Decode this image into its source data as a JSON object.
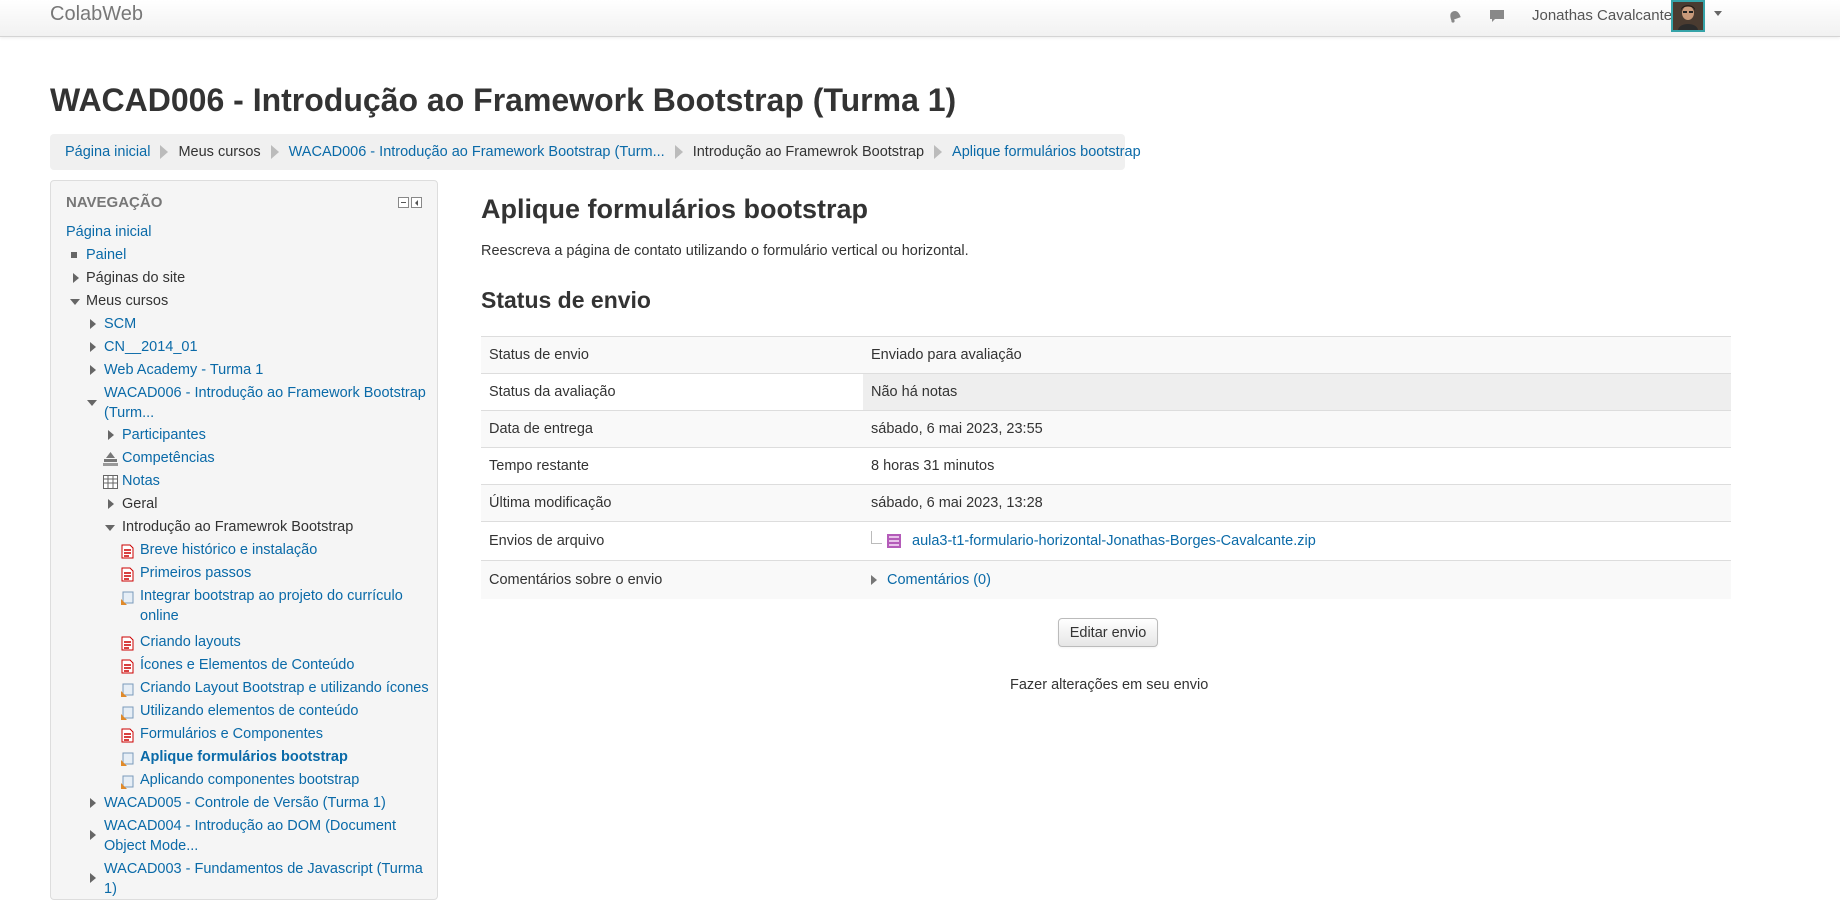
{
  "navbar": {
    "brand": "ColabWeb",
    "user_name": "Jonathas Cavalcante",
    "icons": [
      "notification-bell-icon",
      "messages-icon",
      "user-menu-caret-icon"
    ]
  },
  "page": {
    "heading": "WACAD006 - Introdução ao Framework Bootstrap (Turma 1)"
  },
  "breadcrumb": [
    {
      "label": "Página inicial",
      "link": true
    },
    {
      "label": "Meus cursos",
      "link": false
    },
    {
      "label": "WACAD006 - Introdução ao Framework Bootstrap (Turm...",
      "link": true
    },
    {
      "label": "Introdução ao Framewrok Bootstrap",
      "link": false
    },
    {
      "label": "Aplique formulários bootstrap",
      "link": true
    }
  ],
  "nav": {
    "title": "NAVEGAÇÃO",
    "home": "Página inicial",
    "painel": "Painel",
    "site_pages": "Páginas do site",
    "my_courses": "Meus cursos",
    "courses": {
      "scm": "SCM",
      "cn": "CN__2014_01",
      "web_academy": "Web Academy - Turma 1",
      "wacad006": "WACAD006 - Introdução ao Framework Bootstrap (Turm...",
      "wacad005": "WACAD005 - Controle de Versão (Turma 1)",
      "wacad004": "WACAD004 - Introdução ao DOM (Document Object Mode...",
      "wacad003": "WACAD003 - Fundamentos de Javascript (Turma 1)"
    },
    "course_items": {
      "participants": "Participantes",
      "competencies": "Competências",
      "grades": "Notas",
      "general": "Geral",
      "section": "Introdução ao Framewrok Bootstrap"
    },
    "activities": [
      {
        "label": "Breve histórico e instalação",
        "icon": "pdf-icon"
      },
      {
        "label": "Primeiros passos",
        "icon": "pdf-icon"
      },
      {
        "label": "Integrar bootstrap ao projeto do currículo online",
        "icon": "assignment-icon"
      },
      {
        "label": "Criando layouts",
        "icon": "pdf-icon"
      },
      {
        "label": "Ícones e Elementos de Conteúdo",
        "icon": "pdf-icon"
      },
      {
        "label": "Criando Layout Bootstrap e utilizando ícones",
        "icon": "assignment-icon"
      },
      {
        "label": "Utilizando elementos de conteúdo",
        "icon": "assignment-icon"
      },
      {
        "label": "Formulários e Componentes",
        "icon": "pdf-icon"
      },
      {
        "label": "Aplique formulários bootstrap",
        "icon": "assignment-icon",
        "active": true
      },
      {
        "label": "Aplicando componentes bootstrap",
        "icon": "assignment-icon"
      }
    ]
  },
  "main": {
    "title": "Aplique formulários bootstrap",
    "description": "Reescreva a página de contato utilizando o formulário vertical ou horizontal.",
    "status_heading": "Status de envio",
    "rows": [
      {
        "label": "Status de envio",
        "value": "Enviado para avaliação"
      },
      {
        "label": "Status da avaliação",
        "value": "Não há notas"
      },
      {
        "label": "Data de entrega",
        "value": "sábado, 6 mai 2023, 23:55"
      },
      {
        "label": "Tempo restante",
        "value": "8 horas 31 minutos"
      },
      {
        "label": "Última modificação",
        "value": "sábado, 6 mai 2023, 13:28"
      },
      {
        "label": "Envios de arquivo",
        "value": "aula3-t1-formulario-horizontal-Jonathas-Borges-Cavalcante.zip"
      },
      {
        "label": "Comentários sobre o envio",
        "value": "Comentários (0)"
      }
    ],
    "edit_button": "Editar envio",
    "edit_hint": "Fazer alterações em seu envio"
  }
}
